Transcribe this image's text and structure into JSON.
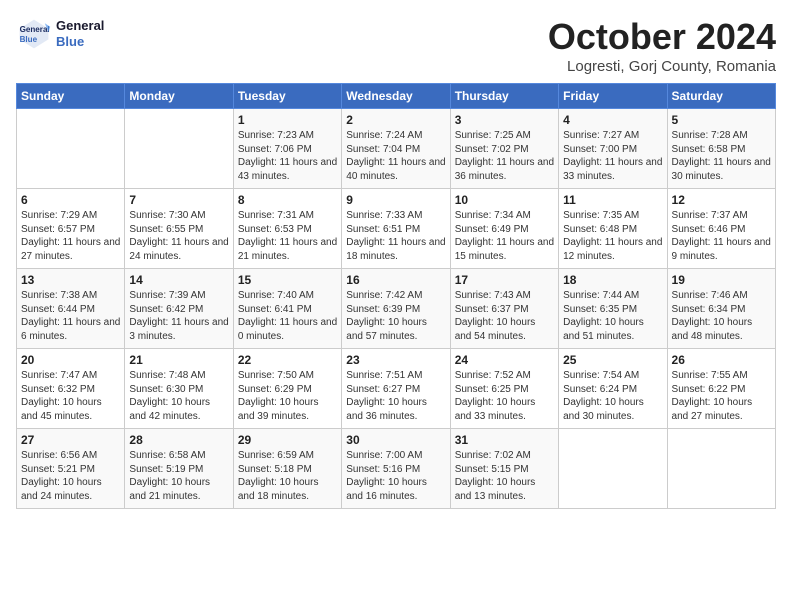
{
  "header": {
    "logo_line1": "General",
    "logo_line2": "Blue",
    "month": "October 2024",
    "location": "Logresti, Gorj County, Romania"
  },
  "weekdays": [
    "Sunday",
    "Monday",
    "Tuesday",
    "Wednesday",
    "Thursday",
    "Friday",
    "Saturday"
  ],
  "weeks": [
    [
      {
        "day": "",
        "sunrise": "",
        "sunset": "",
        "daylight": ""
      },
      {
        "day": "",
        "sunrise": "",
        "sunset": "",
        "daylight": ""
      },
      {
        "day": "1",
        "sunrise": "Sunrise: 7:23 AM",
        "sunset": "Sunset: 7:06 PM",
        "daylight": "Daylight: 11 hours and 43 minutes."
      },
      {
        "day": "2",
        "sunrise": "Sunrise: 7:24 AM",
        "sunset": "Sunset: 7:04 PM",
        "daylight": "Daylight: 11 hours and 40 minutes."
      },
      {
        "day": "3",
        "sunrise": "Sunrise: 7:25 AM",
        "sunset": "Sunset: 7:02 PM",
        "daylight": "Daylight: 11 hours and 36 minutes."
      },
      {
        "day": "4",
        "sunrise": "Sunrise: 7:27 AM",
        "sunset": "Sunset: 7:00 PM",
        "daylight": "Daylight: 11 hours and 33 minutes."
      },
      {
        "day": "5",
        "sunrise": "Sunrise: 7:28 AM",
        "sunset": "Sunset: 6:58 PM",
        "daylight": "Daylight: 11 hours and 30 minutes."
      }
    ],
    [
      {
        "day": "6",
        "sunrise": "Sunrise: 7:29 AM",
        "sunset": "Sunset: 6:57 PM",
        "daylight": "Daylight: 11 hours and 27 minutes."
      },
      {
        "day": "7",
        "sunrise": "Sunrise: 7:30 AM",
        "sunset": "Sunset: 6:55 PM",
        "daylight": "Daylight: 11 hours and 24 minutes."
      },
      {
        "day": "8",
        "sunrise": "Sunrise: 7:31 AM",
        "sunset": "Sunset: 6:53 PM",
        "daylight": "Daylight: 11 hours and 21 minutes."
      },
      {
        "day": "9",
        "sunrise": "Sunrise: 7:33 AM",
        "sunset": "Sunset: 6:51 PM",
        "daylight": "Daylight: 11 hours and 18 minutes."
      },
      {
        "day": "10",
        "sunrise": "Sunrise: 7:34 AM",
        "sunset": "Sunset: 6:49 PM",
        "daylight": "Daylight: 11 hours and 15 minutes."
      },
      {
        "day": "11",
        "sunrise": "Sunrise: 7:35 AM",
        "sunset": "Sunset: 6:48 PM",
        "daylight": "Daylight: 11 hours and 12 minutes."
      },
      {
        "day": "12",
        "sunrise": "Sunrise: 7:37 AM",
        "sunset": "Sunset: 6:46 PM",
        "daylight": "Daylight: 11 hours and 9 minutes."
      }
    ],
    [
      {
        "day": "13",
        "sunrise": "Sunrise: 7:38 AM",
        "sunset": "Sunset: 6:44 PM",
        "daylight": "Daylight: 11 hours and 6 minutes."
      },
      {
        "day": "14",
        "sunrise": "Sunrise: 7:39 AM",
        "sunset": "Sunset: 6:42 PM",
        "daylight": "Daylight: 11 hours and 3 minutes."
      },
      {
        "day": "15",
        "sunrise": "Sunrise: 7:40 AM",
        "sunset": "Sunset: 6:41 PM",
        "daylight": "Daylight: 11 hours and 0 minutes."
      },
      {
        "day": "16",
        "sunrise": "Sunrise: 7:42 AM",
        "sunset": "Sunset: 6:39 PM",
        "daylight": "Daylight: 10 hours and 57 minutes."
      },
      {
        "day": "17",
        "sunrise": "Sunrise: 7:43 AM",
        "sunset": "Sunset: 6:37 PM",
        "daylight": "Daylight: 10 hours and 54 minutes."
      },
      {
        "day": "18",
        "sunrise": "Sunrise: 7:44 AM",
        "sunset": "Sunset: 6:35 PM",
        "daylight": "Daylight: 10 hours and 51 minutes."
      },
      {
        "day": "19",
        "sunrise": "Sunrise: 7:46 AM",
        "sunset": "Sunset: 6:34 PM",
        "daylight": "Daylight: 10 hours and 48 minutes."
      }
    ],
    [
      {
        "day": "20",
        "sunrise": "Sunrise: 7:47 AM",
        "sunset": "Sunset: 6:32 PM",
        "daylight": "Daylight: 10 hours and 45 minutes."
      },
      {
        "day": "21",
        "sunrise": "Sunrise: 7:48 AM",
        "sunset": "Sunset: 6:30 PM",
        "daylight": "Daylight: 10 hours and 42 minutes."
      },
      {
        "day": "22",
        "sunrise": "Sunrise: 7:50 AM",
        "sunset": "Sunset: 6:29 PM",
        "daylight": "Daylight: 10 hours and 39 minutes."
      },
      {
        "day": "23",
        "sunrise": "Sunrise: 7:51 AM",
        "sunset": "Sunset: 6:27 PM",
        "daylight": "Daylight: 10 hours and 36 minutes."
      },
      {
        "day": "24",
        "sunrise": "Sunrise: 7:52 AM",
        "sunset": "Sunset: 6:25 PM",
        "daylight": "Daylight: 10 hours and 33 minutes."
      },
      {
        "day": "25",
        "sunrise": "Sunrise: 7:54 AM",
        "sunset": "Sunset: 6:24 PM",
        "daylight": "Daylight: 10 hours and 30 minutes."
      },
      {
        "day": "26",
        "sunrise": "Sunrise: 7:55 AM",
        "sunset": "Sunset: 6:22 PM",
        "daylight": "Daylight: 10 hours and 27 minutes."
      }
    ],
    [
      {
        "day": "27",
        "sunrise": "Sunrise: 6:56 AM",
        "sunset": "Sunset: 5:21 PM",
        "daylight": "Daylight: 10 hours and 24 minutes."
      },
      {
        "day": "28",
        "sunrise": "Sunrise: 6:58 AM",
        "sunset": "Sunset: 5:19 PM",
        "daylight": "Daylight: 10 hours and 21 minutes."
      },
      {
        "day": "29",
        "sunrise": "Sunrise: 6:59 AM",
        "sunset": "Sunset: 5:18 PM",
        "daylight": "Daylight: 10 hours and 18 minutes."
      },
      {
        "day": "30",
        "sunrise": "Sunrise: 7:00 AM",
        "sunset": "Sunset: 5:16 PM",
        "daylight": "Daylight: 10 hours and 16 minutes."
      },
      {
        "day": "31",
        "sunrise": "Sunrise: 7:02 AM",
        "sunset": "Sunset: 5:15 PM",
        "daylight": "Daylight: 10 hours and 13 minutes."
      },
      {
        "day": "",
        "sunrise": "",
        "sunset": "",
        "daylight": ""
      },
      {
        "day": "",
        "sunrise": "",
        "sunset": "",
        "daylight": ""
      }
    ]
  ]
}
